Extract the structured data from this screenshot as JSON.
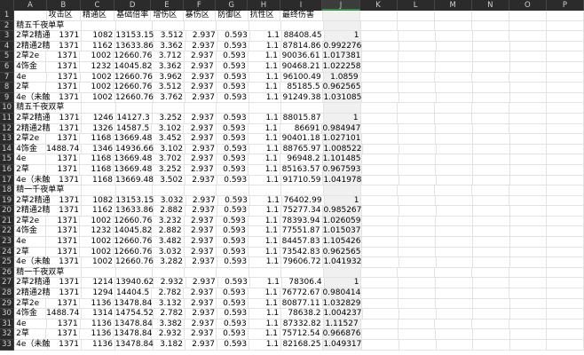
{
  "columns": [
    "A",
    "B",
    "C",
    "D",
    "E",
    "F",
    "G",
    "H",
    "I",
    "J",
    "K",
    "L",
    "M",
    "N",
    "O",
    "P"
  ],
  "header_row": [
    "",
    "攻击区",
    "精通区",
    "基础倍率",
    "增伤区",
    "暴伤区",
    "防御区",
    "抗性区",
    "最终伤害",
    ""
  ],
  "rows": [
    {
      "n": "1",
      "cells": [
        "",
        "攻击区",
        "精通区",
        "基础倍率",
        "增伤区",
        "暴伤区",
        "防御区",
        "抗性区",
        "最终伤害",
        ""
      ]
    },
    {
      "n": "2",
      "cells": [
        "精五千夜单草",
        "",
        "",
        "",
        "",
        "",
        "",
        "",
        "",
        ""
      ]
    },
    {
      "n": "3",
      "cells": [
        "2草2精通",
        "1371",
        "1082",
        "13153.15",
        "3.512",
        "2.937",
        "0.593",
        "1.1",
        "88408.45",
        "1"
      ]
    },
    {
      "n": "4",
      "cells": [
        "2精通2精",
        "1371",
        "1162",
        "13633.86",
        "3.362",
        "2.937",
        "0.593",
        "1.1",
        "87814.86",
        "0.992276"
      ]
    },
    {
      "n": "5",
      "cells": [
        "2草2e",
        "1371",
        "1002",
        "12660.76",
        "3.712",
        "2.937",
        "0.593",
        "1.1",
        "90036.61",
        "1.017381"
      ]
    },
    {
      "n": "6",
      "cells": [
        "4饰金",
        "1371",
        "1232",
        "14045.82",
        "3.362",
        "2.937",
        "0.593",
        "1.1",
        "90468.21",
        "1.022258"
      ]
    },
    {
      "n": "7",
      "cells": [
        "4e",
        "1371",
        "1002",
        "12660.76",
        "3.962",
        "2.937",
        "0.593",
        "1.1",
        "96100.49",
        "1.0859"
      ]
    },
    {
      "n": "8",
      "cells": [
        "2草",
        "1371",
        "1002",
        "12660.76",
        "3.512",
        "2.937",
        "0.593",
        "1.1",
        "85185.5",
        "0.962565"
      ]
    },
    {
      "n": "9",
      "cells": [
        "4e（未触",
        "1371",
        "1002",
        "12660.76",
        "3.762",
        "2.937",
        "0.593",
        "1.1",
        "91249.38",
        "1.031085"
      ]
    },
    {
      "n": "10",
      "cells": [
        "精五千夜双草",
        "",
        "",
        "",
        "",
        "",
        "",
        "",
        "",
        ""
      ]
    },
    {
      "n": "11",
      "cells": [
        "2草2精通",
        "1371",
        "1246",
        "14127.3",
        "3.252",
        "2.937",
        "0.593",
        "1.1",
        "88015.87",
        "1"
      ]
    },
    {
      "n": "12",
      "cells": [
        "2精通2精",
        "1371",
        "1326",
        "14587.5",
        "3.102",
        "2.937",
        "0.593",
        "1.1",
        "86691",
        "0.984947"
      ]
    },
    {
      "n": "13",
      "cells": [
        "2草2e",
        "1371",
        "1168",
        "13669.48",
        "3.452",
        "2.937",
        "0.593",
        "1.1",
        "90401.18",
        "1.027101"
      ]
    },
    {
      "n": "14",
      "cells": [
        "4饰金",
        "1488.74",
        "1346",
        "14936.66",
        "3.102",
        "2.937",
        "0.593",
        "1.1",
        "88765.97",
        "1.008522"
      ]
    },
    {
      "n": "15",
      "cells": [
        "4e",
        "1371",
        "1168",
        "13669.48",
        "3.702",
        "2.937",
        "0.593",
        "1.1",
        "96948.2",
        "1.101485"
      ]
    },
    {
      "n": "16",
      "cells": [
        "2草",
        "1371",
        "1168",
        "13669.48",
        "3.252",
        "2.937",
        "0.593",
        "1.1",
        "85163.57",
        "0.967593"
      ]
    },
    {
      "n": "17",
      "cells": [
        "4e（未触",
        "1371",
        "1168",
        "13669.48",
        "3.502",
        "2.937",
        "0.593",
        "1.1",
        "91710.59",
        "1.041978"
      ]
    },
    {
      "n": "18",
      "cells": [
        "精一千夜单草",
        "",
        "",
        "",
        "",
        "",
        "",
        "",
        "",
        ""
      ]
    },
    {
      "n": "19",
      "cells": [
        "2草2精通",
        "1371",
        "1082",
        "13153.15",
        "3.032",
        "2.937",
        "0.593",
        "1.1",
        "76402.99",
        "1"
      ]
    },
    {
      "n": "20",
      "cells": [
        "2精通2精",
        "1371",
        "1162",
        "13633.86",
        "2.882",
        "2.937",
        "0.593",
        "1.1",
        "75277.34",
        "0.985267"
      ]
    },
    {
      "n": "21",
      "cells": [
        "2草2e",
        "1371",
        "1002",
        "12660.76",
        "3.232",
        "2.937",
        "0.593",
        "1.1",
        "78393.94",
        "1.026059"
      ]
    },
    {
      "n": "22",
      "cells": [
        "4饰金",
        "1371",
        "1232",
        "14045.82",
        "2.882",
        "2.937",
        "0.593",
        "1.1",
        "77551.87",
        "1.015037"
      ]
    },
    {
      "n": "23",
      "cells": [
        "4e",
        "1371",
        "1002",
        "12660.76",
        "3.482",
        "2.937",
        "0.593",
        "1.1",
        "84457.83",
        "1.105426"
      ]
    },
    {
      "n": "24",
      "cells": [
        "2草",
        "1371",
        "1002",
        "12660.76",
        "3.032",
        "2.937",
        "0.593",
        "1.1",
        "73542.83",
        "0.962565"
      ]
    },
    {
      "n": "25",
      "cells": [
        "4e（未触",
        "1371",
        "1002",
        "12660.76",
        "3.282",
        "2.937",
        "0.593",
        "1.1",
        "79606.72",
        "1.041932"
      ]
    },
    {
      "n": "26",
      "cells": [
        "精一千夜双草",
        "",
        "",
        "",
        "",
        "",
        "",
        "",
        "",
        ""
      ]
    },
    {
      "n": "27",
      "cells": [
        "2草2精通",
        "1371",
        "1214",
        "13940.62",
        "2.932",
        "2.937",
        "0.593",
        "1.1",
        "78306.4",
        "1"
      ]
    },
    {
      "n": "28",
      "cells": [
        "2精通2精",
        "1371",
        "1294",
        "14404.5",
        "2.782",
        "2.937",
        "0.593",
        "1.1",
        "76772.67",
        "0.980414"
      ]
    },
    {
      "n": "29",
      "cells": [
        "2草2e",
        "1371",
        "1136",
        "13478.84",
        "3.132",
        "2.937",
        "0.593",
        "1.1",
        "80877.11",
        "1.032829"
      ]
    },
    {
      "n": "30",
      "cells": [
        "4饰金",
        "1488.74",
        "1314",
        "14754.52",
        "2.782",
        "2.937",
        "0.593",
        "1.1",
        "78638.2",
        "1.004237"
      ]
    },
    {
      "n": "31",
      "cells": [
        "4e",
        "1371",
        "1136",
        "13478.84",
        "3.382",
        "2.937",
        "0.593",
        "1.1",
        "87332.82",
        "1.11527"
      ]
    },
    {
      "n": "32",
      "cells": [
        "2草",
        "1371",
        "1136",
        "13478.84",
        "2.932",
        "2.937",
        "0.593",
        "1.1",
        "75712.54",
        "0.966876"
      ]
    },
    {
      "n": "33",
      "cells": [
        "4e（未触",
        "1371",
        "1136",
        "13478.84",
        "3.182",
        "2.937",
        "0.593",
        "1.1",
        "82168.25",
        "1.049317"
      ]
    }
  ]
}
